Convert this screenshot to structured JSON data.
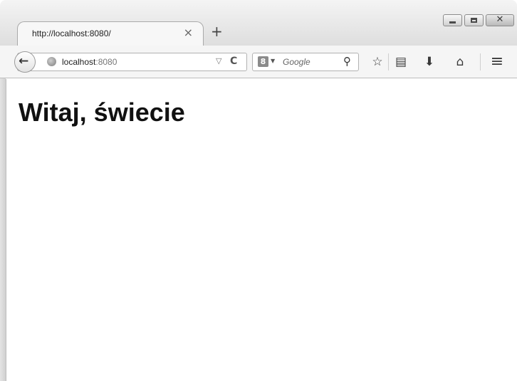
{
  "tab": {
    "title": "http://localhost:8080/",
    "close_glyph": "×",
    "new_tab_glyph": "+"
  },
  "window_controls": {
    "minimize_icon": "minimize-icon",
    "maximize_icon": "maximize-icon",
    "close_glyph": "✕"
  },
  "navbar": {
    "back_glyph": "←",
    "url_host": "localhost",
    "url_port": ":8080",
    "dropdown_glyph": "▽",
    "reload_glyph": "C",
    "search_engine_glyph": "8",
    "search_dropdown_glyph": "▼",
    "search_placeholder": "Google",
    "search_glyph": "⚲",
    "bookmark_star_glyph": "☆",
    "reading_list_glyph": "▤",
    "download_glyph": "⬇",
    "home_glyph": "⌂",
    "menu_glyph": "≡"
  },
  "page": {
    "heading": "Witaj, świecie"
  }
}
